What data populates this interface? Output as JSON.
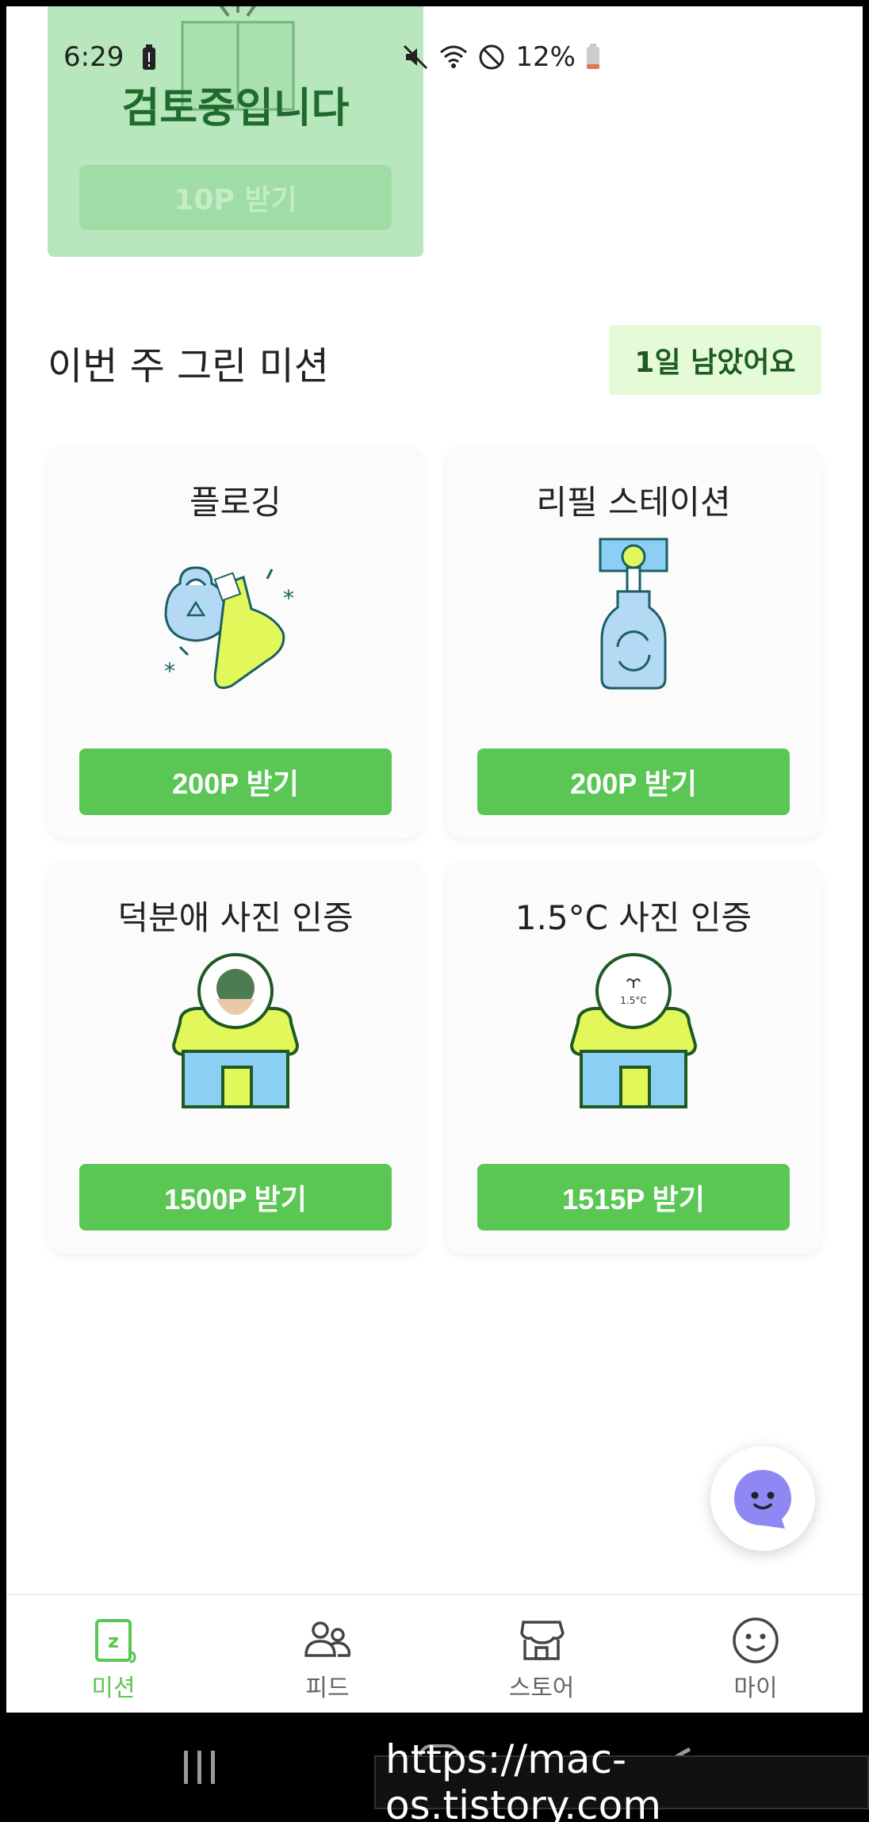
{
  "status_bar": {
    "time": "6:29",
    "battery_pct": "12%"
  },
  "review_card": {
    "title": "검토중입니다",
    "button": "10P 받기"
  },
  "section": {
    "title": "이번 주 그린 미션",
    "days_left": "1일 남았어요"
  },
  "missions": [
    {
      "title": "플로깅",
      "button": "200P 받기",
      "icon": "plogging-icon"
    },
    {
      "title": "리필 스테이션",
      "button": "200P 받기",
      "icon": "refill-spray-icon"
    },
    {
      "title": "덕분애 사진 인증",
      "button": "1500P 받기",
      "icon": "store-earth-icon"
    },
    {
      "title": "1.5°C 사진 인증",
      "button": "1515P 받기",
      "icon": "store-sprout-icon",
      "badge_text": "1.5°C"
    }
  ],
  "bottom_nav": [
    {
      "label": "미션",
      "icon": "mission-icon",
      "active": true
    },
    {
      "label": "피드",
      "icon": "people-icon",
      "active": false
    },
    {
      "label": "스토어",
      "icon": "store-icon",
      "active": false
    },
    {
      "label": "마이",
      "icon": "smile-icon",
      "active": false
    }
  ],
  "watermark": "https://mac-os.tistory.com",
  "colors": {
    "accent": "#5ac653",
    "badge_bg": "#e5fbd8",
    "review_bg": "#b8e6bd"
  }
}
